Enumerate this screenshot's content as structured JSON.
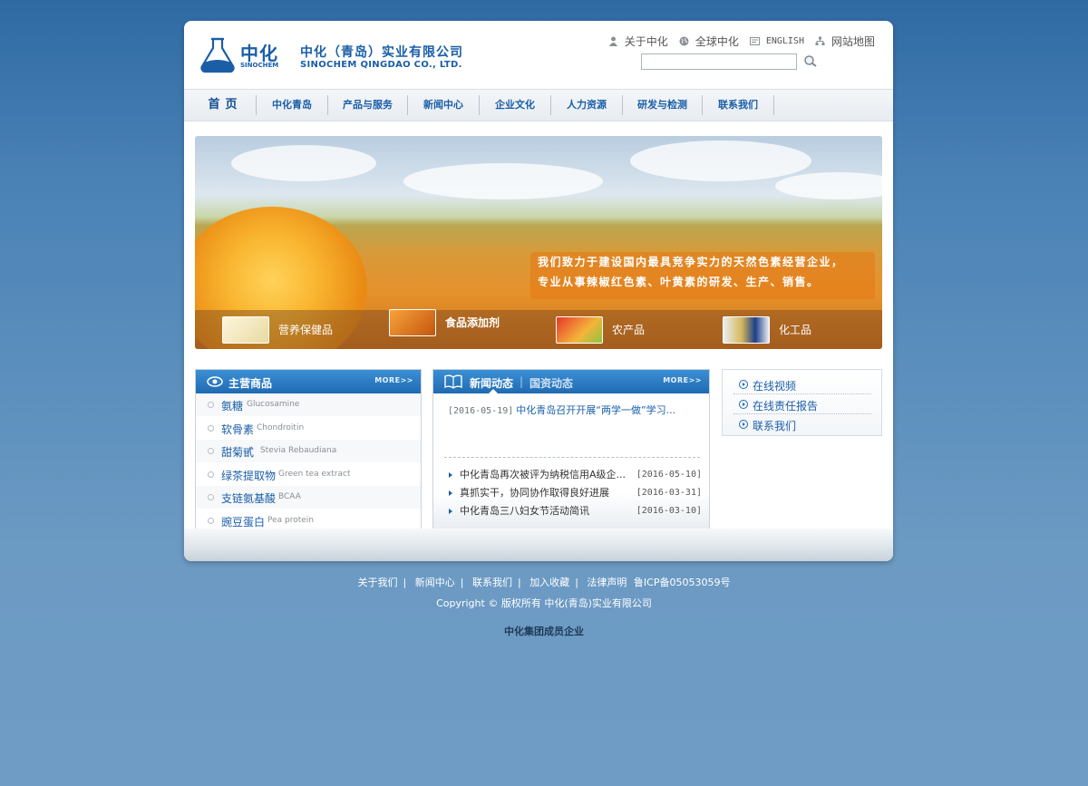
{
  "header": {
    "logo_cn": "中化",
    "logo_en": "SINOCHEM",
    "company_cn": "中化（青岛）实业有限公司",
    "company_en": "SINOCHEM QINGDAO CO., LTD.",
    "toplinks": [
      {
        "label": "关于中化",
        "icon": "person-icon"
      },
      {
        "label": "全球中化",
        "icon": "globe-icon"
      },
      {
        "label": "ENGLISH",
        "icon": "language-icon"
      },
      {
        "label": "网站地图",
        "icon": "sitemap-icon"
      }
    ],
    "search": {
      "value": "",
      "icon": "search-icon"
    }
  },
  "nav": {
    "items": [
      "首页",
      "中化青岛",
      "产品与服务",
      "新闻中心",
      "企业文化",
      "人力资源",
      "研发与检测",
      "联系我们"
    ]
  },
  "banner": {
    "slogan_line1": "我们致力于建设国内最具竞争实力的天然色素经营企业，",
    "slogan_line2": "专业从事辣椒红色素、叶黄素的研发、生产、销售。",
    "categories": [
      {
        "label": "营养保健品",
        "active": false
      },
      {
        "label": "食品添加剂",
        "active": true
      },
      {
        "label": "农产品",
        "active": false
      },
      {
        "label": "化工品",
        "active": false
      }
    ]
  },
  "products": {
    "title": "主营商品",
    "more": "MORE>>",
    "items": [
      {
        "cn": "氨糖",
        "en": "Glucosamine"
      },
      {
        "cn": "软骨素",
        "en": "Chondroitin"
      },
      {
        "cn": "甜菊甙",
        "en": "Stevia Rebaudiana"
      },
      {
        "cn": "绿茶提取物",
        "en": "Green tea extract"
      },
      {
        "cn": "支链氨基酸",
        "en": "BCAA"
      },
      {
        "cn": "豌豆蛋白",
        "en": "Pea protein"
      }
    ]
  },
  "news": {
    "tab_active": "新闻动态",
    "separator": "|",
    "tab_other": "国资动态",
    "more": "MORE>>",
    "top": {
      "date": "[2016-05-19]",
      "title": "中化青岛召开开展“两学一做”学习..."
    },
    "items": [
      {
        "title": "中化青岛再次被评为纳税信用A级企...",
        "date": "[2016-05-10]"
      },
      {
        "title": "真抓实干，协同协作取得良好进展",
        "date": "[2016-03-31]"
      },
      {
        "title": "中化青岛三八妇女节活动简讯",
        "date": "[2016-03-10]"
      }
    ]
  },
  "quick_links": [
    "在线视频",
    "在线责任报告",
    "联系我们"
  ],
  "footer": {
    "links": [
      "关于我们",
      "新闻中心",
      "联系我们",
      "加入收藏",
      "法律声明"
    ],
    "separator": "|",
    "icp": "鲁ICP备05053059号",
    "copyright": "Copyright © 版权所有  中化(青岛)实业有限公司",
    "member": "中化集团成员企业"
  },
  "colors": {
    "brand_blue": "#1a5ea8",
    "page_bg": "#6f9cc5",
    "box_head": "#1f6bb3"
  }
}
